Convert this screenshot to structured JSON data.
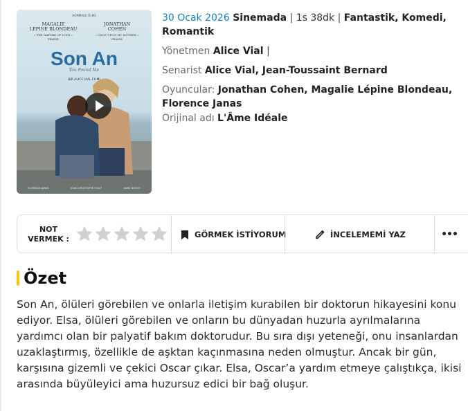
{
  "poster": {
    "credit_top": "HOMMAGE FILMS",
    "actor_left_first": "MAGALIE",
    "actor_left_last": "LÉPINE BLONDEAU",
    "actor_right_first": "JONATHAN",
    "actor_right_last": "COHEN",
    "tagline_left_1": "« THE NATURE OF LOVE »",
    "tagline_left_2": "PRAISE",
    "tagline_right_1": "« ONCE UPON MY MOTHER »",
    "tagline_right_2": "PRAISE",
    "title": "Son An",
    "subtitle": "You Found Me",
    "director_line": "BIR ALICE VIAL FILMI",
    "bottom_credits_1": "FLORENCE JANAS",
    "bottom_credits_2": "JEAN-CHRISTOPHE FOLLY",
    "bottom_credits_3": "ANNE BENOIT"
  },
  "meta": {
    "date": "30 Ocak 2026",
    "release_label": "Sinemada",
    "sep1": "|",
    "duration": "1s 38dk",
    "sep2": "|",
    "genres": "Fantastik, Komedi, Romantik",
    "director_label": "Yönetmen",
    "director": "Alice Vial",
    "director_sep": "|",
    "writer_label": "Senarist",
    "writers": "Alice Vial, Jean-Toussaint Bernard",
    "cast_label": "Oyuncular:",
    "cast": "Jonathan Cohen, Magalie Lépine Blondeau, Florence Janas",
    "original_label": "Orijinal adı",
    "original_title": "L'Âme Idéale"
  },
  "actions": {
    "rate_label_1": "NOT",
    "rate_label_2": "VERMEK :",
    "star_count": 5,
    "rating": 0,
    "want_to_see": "GÖRMEK İSTİYORUM",
    "write_review": "İNCELEMEMİ YAZ",
    "more": "•••"
  },
  "summary": {
    "title": "Özet",
    "text": "Son An, ölüleri görebilen ve onlarla iletişim kurabilen bir doktorun hikayesini konu ediyor. Elsa, ölüleri görebilen ve onların bu dünyadan huzurla ayrılmalarına yardımcı olan bir palyatif bakım doktorudur. Bu sıra dışı yeteneği, onu insanlardan uzaklaştırmış, özellikle de aşktan kaçınmasına neden olmuştur. Ancak bir gün, karşısına gizemli ve çekici Oscar çıkar. Elsa, Oscar’a yardım etmeye çalıştıkça, ikisi arasında büyüleyici ama huzursuz edici bir bağ oluşur."
  },
  "colors": {
    "accent": "#f5c518",
    "date_blue": "#1a7fc1",
    "star_empty": "#d0d0d0"
  }
}
